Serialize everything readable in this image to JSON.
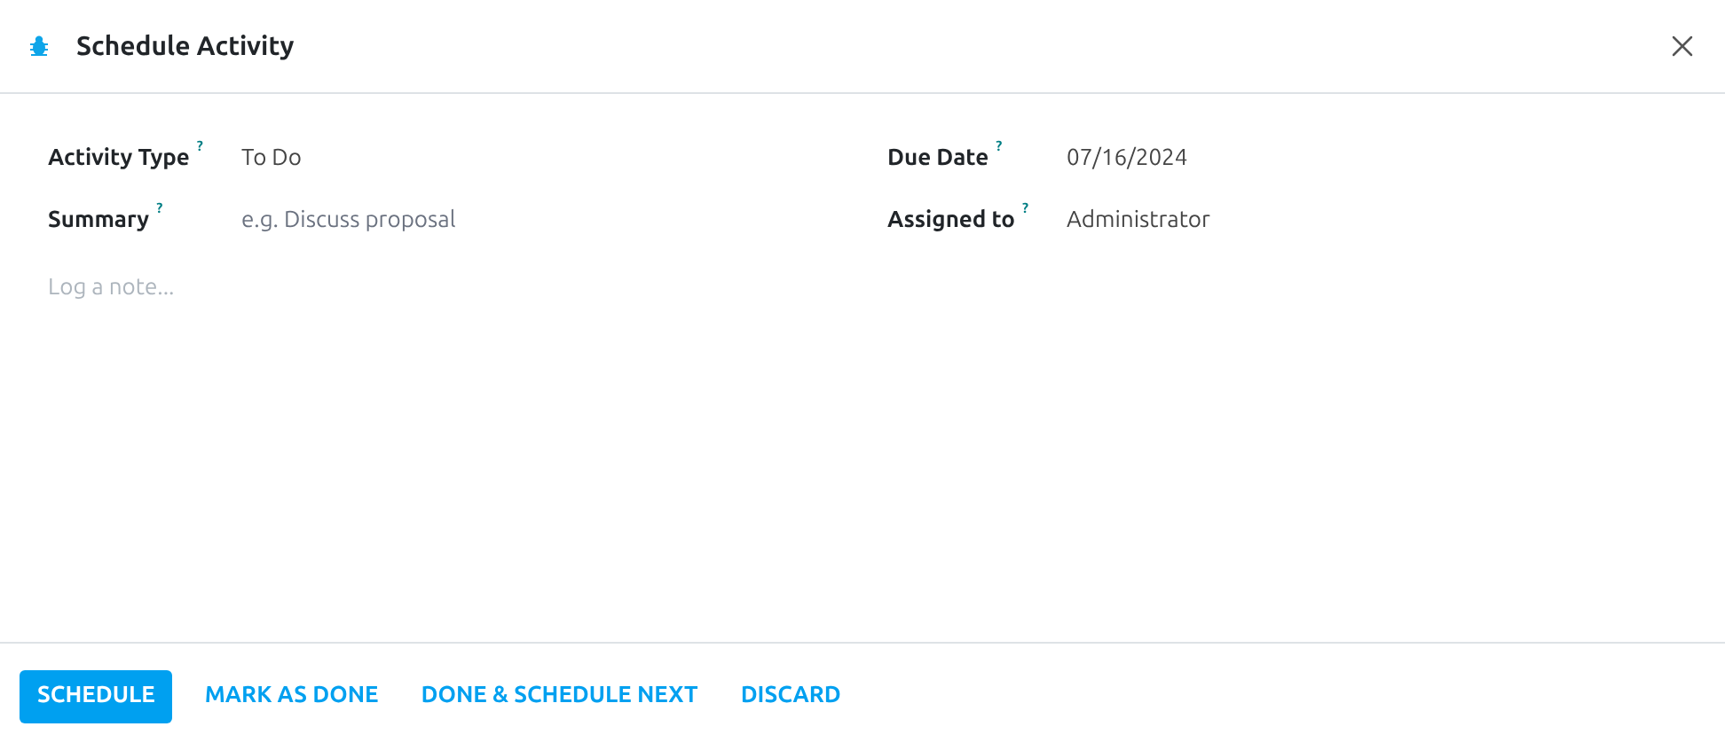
{
  "dialog": {
    "title": "Schedule Activity"
  },
  "left_fields": [
    {
      "label": "Activity Type",
      "help": "?",
      "value": "To Do"
    },
    {
      "label": "Summary",
      "help": "?",
      "placeholder": "e.g. Discuss proposal"
    }
  ],
  "right_fields": [
    {
      "label": "Due Date",
      "help": "?",
      "value": "07/16/2024"
    },
    {
      "label": "Assigned to",
      "help": "?",
      "value": "Administrator"
    }
  ],
  "note": {
    "placeholder": "Log a note..."
  },
  "buttons": [
    {
      "label": "SCHEDULE",
      "kind": "primary"
    },
    {
      "label": "MARK AS DONE",
      "kind": "link"
    },
    {
      "label": "DONE & SCHEDULE NEXT",
      "kind": "link"
    },
    {
      "label": "DISCARD",
      "kind": "link"
    }
  ]
}
